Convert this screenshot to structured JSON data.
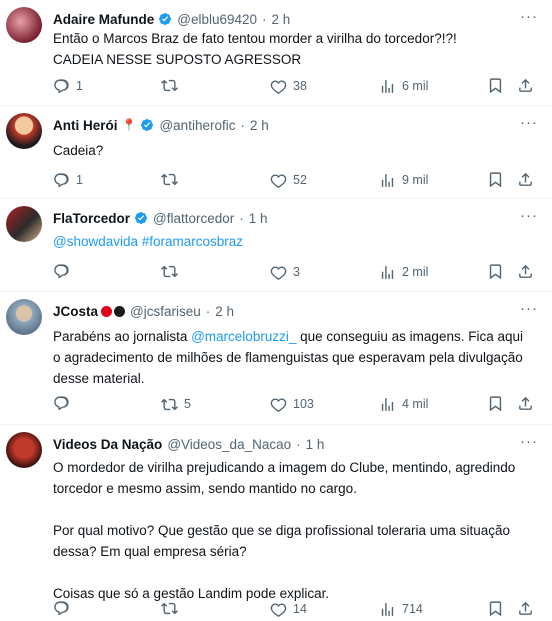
{
  "tweets": [
    {
      "name": "Adaire Mafunde",
      "verified": true,
      "handle": "@elblu69420",
      "time": "2 h",
      "text": "Então o Marcos Braz de fato tentou morder a virilha do torcedor?!?!\nCADEIA NESSE SUPOSTO AGRESSOR",
      "replies": "1",
      "retweets": "",
      "likes": "38",
      "views": "6 mil"
    },
    {
      "name": "Anti Herói",
      "emoji": "📍",
      "verified": true,
      "handle": "@antiherofic",
      "time": "2 h",
      "text": "Cadeia?",
      "replies": "1",
      "retweets": "",
      "likes": "52",
      "views": "9 mil"
    },
    {
      "name": "FlaTorcedor",
      "verified": true,
      "handle": "@flattorcedor",
      "time": "1 h",
      "text": "@showdavida #foramarcosbraz",
      "replies": "",
      "retweets": "",
      "likes": "3",
      "views": "2 mil"
    },
    {
      "name": "JCosta",
      "verified": false,
      "handle": "@jcsfariseu",
      "time": "2 h",
      "text_before": "Parabéns ao jornalista ",
      "mention": "@marcelobruzzi_",
      "text_after": " que conseguiu as imagens. Fica aqui o agradecimento de milhões de flamenguistas que esperavam pela divulgação desse material.",
      "replies": "",
      "retweets": "5",
      "likes": "103",
      "views": "4 mil"
    },
    {
      "name": "Videos Da Nação",
      "verified": false,
      "handle": "@Videos_da_Nacao",
      "time": "1 h",
      "text": "O mordedor de virilha prejudicando a imagem do Clube, mentindo, agredindo torcedor e mesmo assim, sendo mantido no cargo.\n\nPor qual motivo? Que gestão que se diga profissional toleraria uma situação dessa? Em qual empresa séria?\n\nCoisas que só a gestão Landim pode explicar.",
      "replies": "",
      "retweets": "",
      "likes": "14",
      "views": "714"
    }
  ],
  "colors": {
    "text": "#0f1419",
    "secondary": "#536471",
    "link": "#1d9bf0",
    "verified": "#1d9bf0",
    "divider": "#eff3f4"
  },
  "separator": "·",
  "icons": [
    "reply-icon",
    "retweet-icon",
    "like-icon",
    "views-icon",
    "bookmark-icon",
    "share-icon",
    "more-icon",
    "verified-badge-icon"
  ]
}
